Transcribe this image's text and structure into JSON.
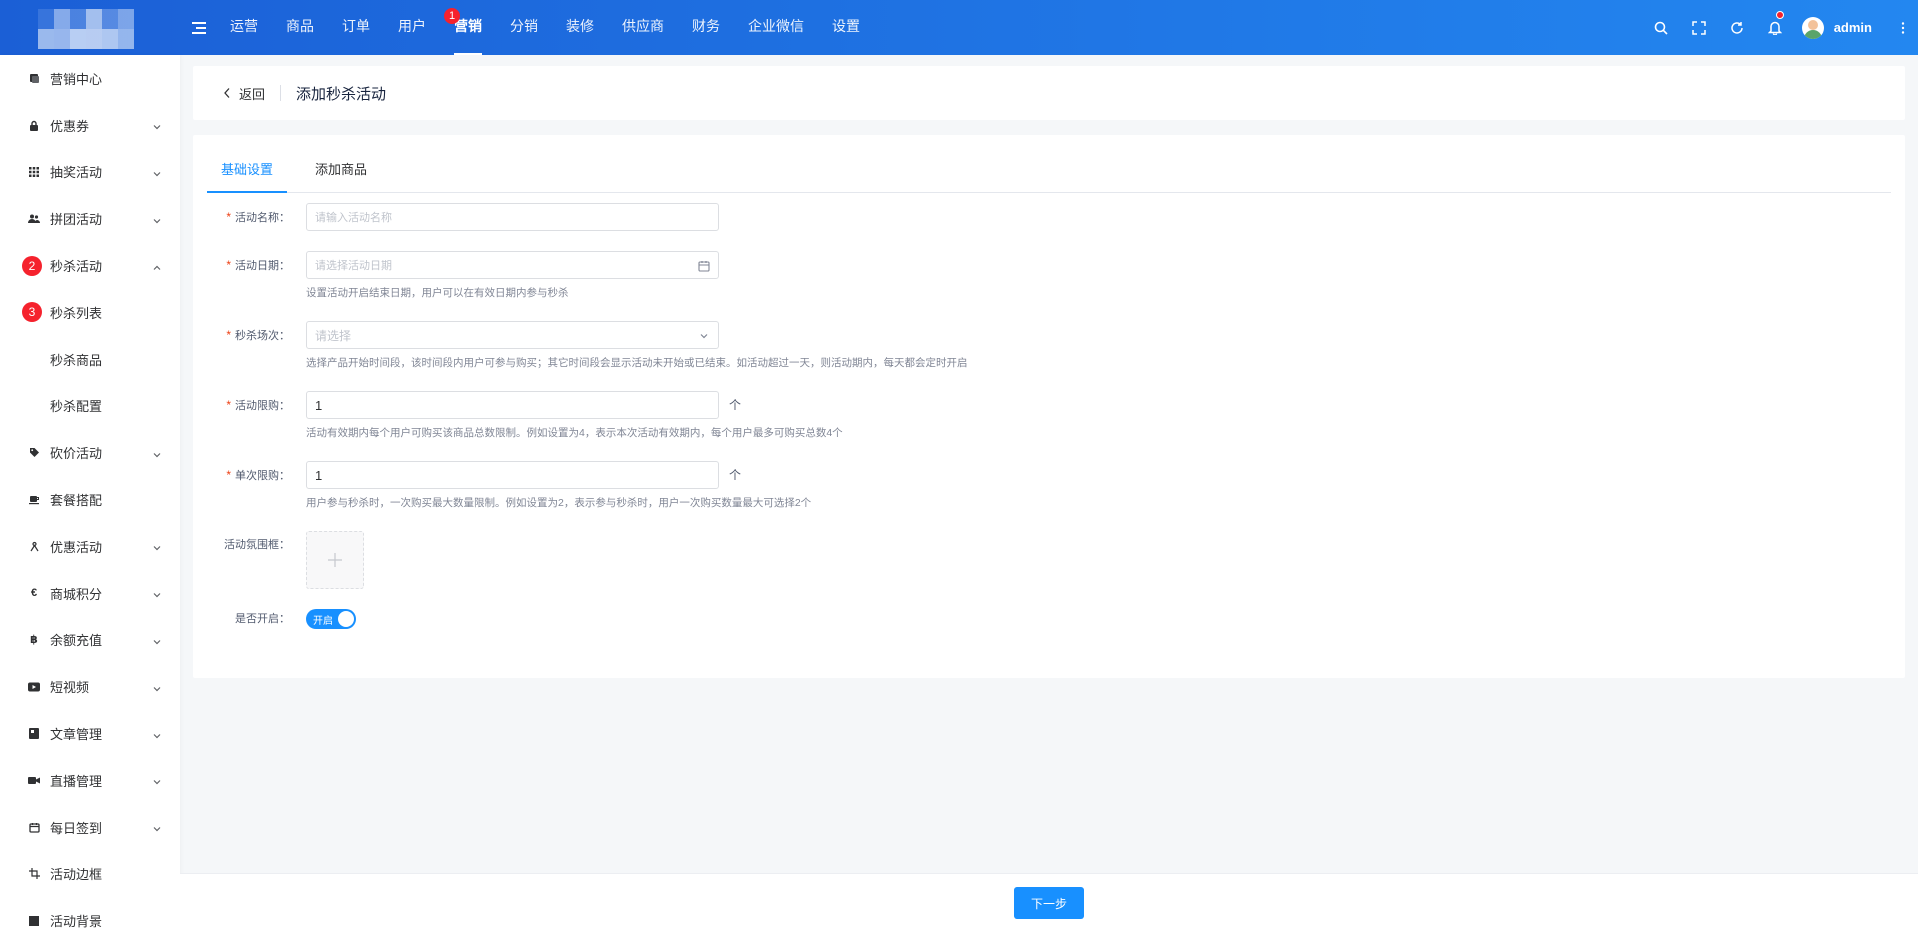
{
  "header": {
    "nav": [
      {
        "label": "运营"
      },
      {
        "label": "商品"
      },
      {
        "label": "订单"
      },
      {
        "label": "用户"
      },
      {
        "label": "营销",
        "active": true,
        "badge": "1"
      },
      {
        "label": "分销"
      },
      {
        "label": "装修"
      },
      {
        "label": "供应商"
      },
      {
        "label": "财务"
      },
      {
        "label": "企业微信"
      },
      {
        "label": "设置"
      }
    ],
    "username": "admin"
  },
  "sidebar": {
    "items": [
      {
        "label": "营销中心",
        "icon": "marketing-icon"
      },
      {
        "label": "优惠券",
        "icon": "lock-icon",
        "arrow": "down"
      },
      {
        "label": "抽奖活动",
        "icon": "grid-icon",
        "arrow": "down"
      },
      {
        "label": "拼团活动",
        "icon": "group-icon",
        "arrow": "down"
      },
      {
        "label": "秒杀活动",
        "badge": "2",
        "arrow": "up"
      },
      {
        "label": "秒杀列表",
        "badge": "3"
      },
      {
        "label": "秒杀商品",
        "sub": true
      },
      {
        "label": "秒杀配置",
        "sub": true
      },
      {
        "label": "砍价活动",
        "icon": "tag-icon",
        "arrow": "down"
      },
      {
        "label": "套餐搭配",
        "icon": "cup-icon"
      },
      {
        "label": "优惠活动",
        "icon": "gift-icon",
        "arrow": "down"
      },
      {
        "label": "商城积分",
        "icon": "euro-icon",
        "arrow": "down"
      },
      {
        "label": "余额充值",
        "icon": "bitcoin-icon",
        "arrow": "down"
      },
      {
        "label": "短视频",
        "icon": "video-icon",
        "arrow": "down"
      },
      {
        "label": "文章管理",
        "icon": "article-icon",
        "arrow": "down"
      },
      {
        "label": "直播管理",
        "icon": "camera-icon",
        "arrow": "down"
      },
      {
        "label": "每日签到",
        "icon": "calendar-icon",
        "arrow": "down"
      },
      {
        "label": "活动边框",
        "icon": "crop-icon"
      },
      {
        "label": "活动背景",
        "icon": "square-icon"
      }
    ]
  },
  "page": {
    "back_label": "返回",
    "title": "添加秒杀活动",
    "tabs": [
      {
        "label": "基础设置",
        "active": true
      },
      {
        "label": "添加商品"
      }
    ]
  },
  "form": {
    "name": {
      "label": "活动名称：",
      "placeholder": "请输入活动名称"
    },
    "date": {
      "label": "活动日期：",
      "placeholder": "请选择活动日期",
      "tip": "设置活动开启结束日期，用户可以在有效日期内参与秒杀"
    },
    "session": {
      "label": "秒杀场次：",
      "placeholder": "请选择",
      "tip": "选择产品开始时间段，该时间段内用户可参与购买；其它时间段会显示活动未开始或已结束。如活动超过一天，则活动期内，每天都会定时开启"
    },
    "activity_limit": {
      "label": "活动限购：",
      "value": "1",
      "unit": "个",
      "tip": "活动有效期内每个用户可购买该商品总数限制。例如设置为4，表示本次活动有效期内，每个用户最多可购买总数4个"
    },
    "single_limit": {
      "label": "单次限购：",
      "value": "1",
      "unit": "个",
      "tip": "用户参与秒杀时，一次购买最大数量限制。例如设置为2，表示参与秒杀时，用户一次购买数量最大可选择2个"
    },
    "frame": {
      "label": "活动氛围框："
    },
    "enabled": {
      "label": "是否开启：",
      "switch_text": "开启",
      "on": true
    }
  },
  "footer": {
    "next_label": "下一步"
  },
  "colors": {
    "header_start": "#1b5fd6",
    "header_end": "#2387f0",
    "primary": "#1890ff",
    "badge": "#f5222d",
    "required": "#ed4014"
  }
}
